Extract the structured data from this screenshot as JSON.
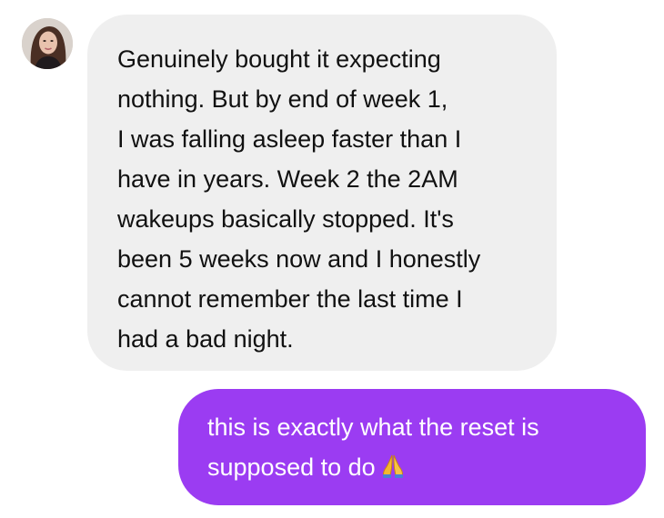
{
  "conversation": {
    "incoming": {
      "lines": [
        "Genuinely bought it expecting",
        "nothing. But by end of week 1,",
        "I was falling asleep faster than I",
        "have in years. Week 2 the 2AM",
        "wakeups basically stopped. It's",
        "been 5 weeks now and I honestly",
        "cannot remember the last time I",
        "had a bad night."
      ]
    },
    "outgoing": {
      "lines": [
        "this is exactly what the reset is",
        "supposed to do"
      ],
      "emoji": "folded-hands-icon"
    }
  },
  "colors": {
    "incoming_bubble": "#efefef",
    "outgoing_bubble": "#9b3cf2",
    "outgoing_text": "#ffffff",
    "incoming_text": "#111111"
  }
}
